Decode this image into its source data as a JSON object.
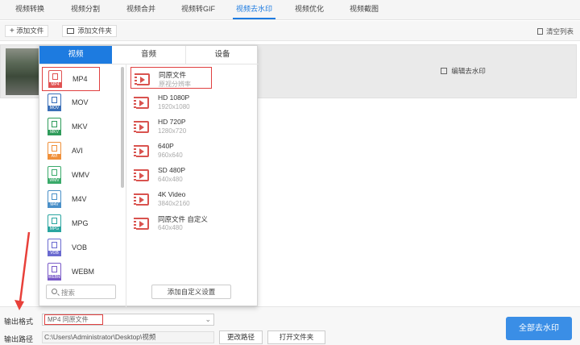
{
  "nav": {
    "tabs": [
      "视频转换",
      "视频分割",
      "视频合并",
      "视频转GIF",
      "视频去水印",
      "视频优化",
      "视频截图"
    ],
    "active_index": 4
  },
  "toolbar": {
    "add_file": "添加文件",
    "add_folder": "添加文件夹",
    "clear_list": "清空列表"
  },
  "file": {
    "edit_watermark": "编辑去水印"
  },
  "popup": {
    "tabs": [
      "视频",
      "音频",
      "设备"
    ],
    "active_tab": 0,
    "formats": [
      {
        "name": "MP4",
        "color": "#e05252",
        "selected": true
      },
      {
        "name": "MOV",
        "color": "#3a6fb8"
      },
      {
        "name": "MKV",
        "color": "#2e9b5a"
      },
      {
        "name": "AVI",
        "color": "#f0903a"
      },
      {
        "name": "WMV",
        "color": "#3aaa6a"
      },
      {
        "name": "M4V",
        "color": "#4a90c8"
      },
      {
        "name": "MPG",
        "color": "#2aa5a0"
      },
      {
        "name": "VOB",
        "color": "#6a6ad0"
      },
      {
        "name": "WEBM",
        "color": "#7a5ac8"
      }
    ],
    "resolutions": [
      {
        "title": "同原文件",
        "subtitle": "原视分辨率",
        "selected": true
      },
      {
        "title": "HD 1080P",
        "subtitle": "1920x1080"
      },
      {
        "title": "HD 720P",
        "subtitle": "1280x720"
      },
      {
        "title": "640P",
        "subtitle": "960x640"
      },
      {
        "title": "SD 480P",
        "subtitle": "640x480"
      },
      {
        "title": "4K Video",
        "subtitle": "3840x2160"
      },
      {
        "title": "同原文件 自定义",
        "subtitle": "640x480"
      }
    ],
    "search_placeholder": "搜索",
    "add_custom": "添加自定义设置"
  },
  "output": {
    "format_label": "输出格式",
    "format_value": "MP4  同原文件",
    "path_label": "输出路径",
    "path_value": "C:\\Users\\Administrator\\Desktop\\视频",
    "change_path": "更改路径",
    "open_folder": "打开文件夹",
    "remove_all": "全部去水印"
  }
}
